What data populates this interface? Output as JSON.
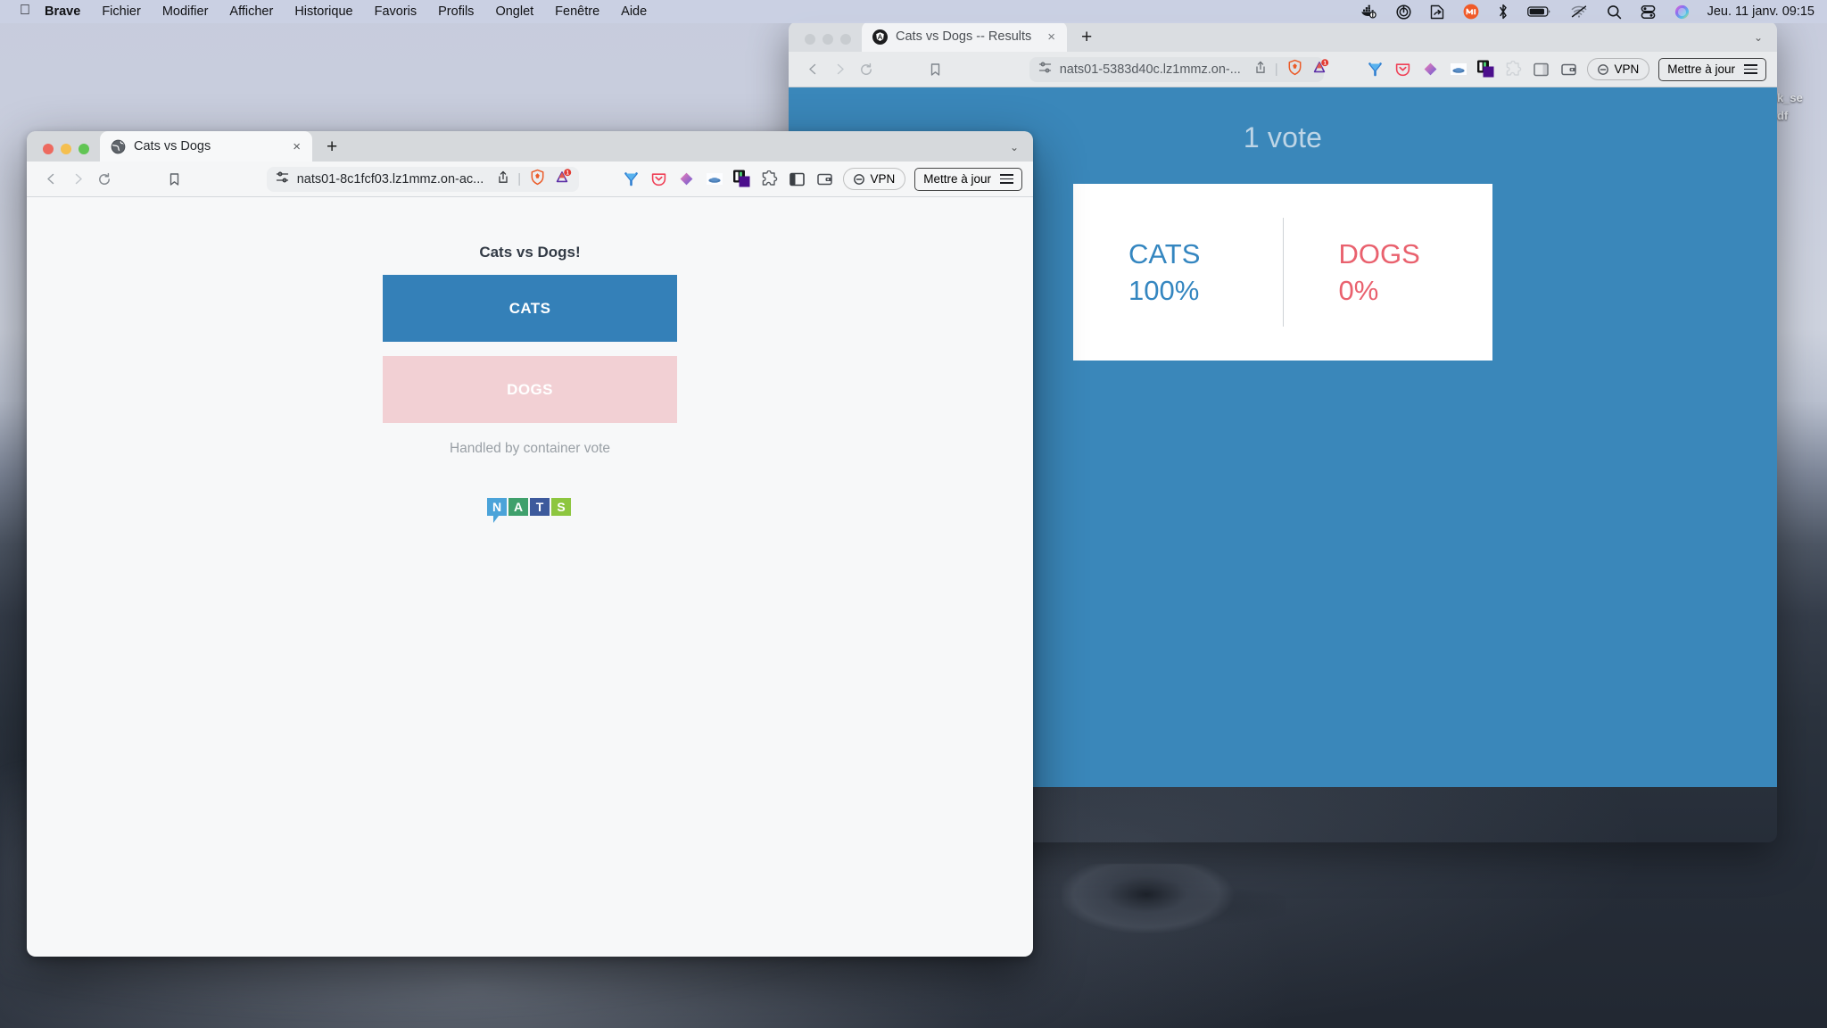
{
  "menubar": {
    "apple_icon": "apple-logo",
    "items": [
      {
        "label": "Brave",
        "bold": true
      },
      {
        "label": "Fichier",
        "bold": false
      },
      {
        "label": "Modifier",
        "bold": false
      },
      {
        "label": "Afficher",
        "bold": false
      },
      {
        "label": "Historique",
        "bold": false
      },
      {
        "label": "Favoris",
        "bold": false
      },
      {
        "label": "Profils",
        "bold": false
      },
      {
        "label": "Onglet",
        "bold": false
      },
      {
        "label": "Fenêtre",
        "bold": false
      },
      {
        "label": "Aide",
        "bold": false
      }
    ],
    "tray_icons": [
      "docker-icon",
      "power-icon",
      "screenshot-icon",
      "m-app-icon",
      "bluetooth-icon",
      "battery-icon",
      "wifi-off-icon",
      "search-icon",
      "control-center-icon",
      "siri-icon"
    ],
    "clock": "Jeu. 11 janv.  09:15"
  },
  "desktop": {
    "icon_labels": [
      "ok_se",
      "odf"
    ]
  },
  "back_window": {
    "tab": {
      "favicon": "angular-icon",
      "title": "Cats vs Dogs -- Results",
      "close_label": "×"
    },
    "newtab_label": "+",
    "chevron_label": "⌄",
    "toolbar": {
      "back_label": "◁",
      "forward_label": "▷",
      "reload_label": "↻",
      "bookmark_icon": "bookmark-icon",
      "permissions_icon": "site-settings-icon",
      "url": "nats01-5383d40c.lz1mmz.on-...",
      "share_icon": "share-icon",
      "brave_shield_icon": "brave-shield-icon",
      "notification_badge": "1",
      "vpn_label": "VPN",
      "update_label": "Mettre à jour",
      "extensions": [
        "yubico-icon",
        "pocket-icon",
        "diamond-icon",
        "cloud-icon",
        "purple-app-icon",
        "puzzle-icon",
        "sidebar-icon",
        "wallet-icon"
      ]
    },
    "page": {
      "vote_count": "1 vote",
      "cats_label": "CATS",
      "cats_percent": "100%",
      "dogs_label": "DOGS",
      "dogs_percent": "0%"
    }
  },
  "front_window": {
    "tab": {
      "favicon": "globe-icon",
      "title": "Cats vs Dogs",
      "close_label": "×"
    },
    "newtab_label": "+",
    "chevron_label": "⌄",
    "traffic_lights": {
      "close": "#ed6a5f",
      "minimize": "#f4bf4f",
      "zoom": "#61c554"
    },
    "toolbar": {
      "back_label": "◁",
      "forward_label": "▷",
      "reload_label": "↻",
      "bookmark_icon": "bookmark-icon",
      "permissions_icon": "site-settings-icon",
      "url": "nats01-8c1fcf03.lz1mmz.on-ac...",
      "share_icon": "share-icon",
      "brave_shield_icon": "brave-shield-icon",
      "notification_badge": "1",
      "vpn_label": "VPN",
      "update_label": "Mettre à jour",
      "extensions": [
        "yubico-icon",
        "pocket-icon",
        "diamond-icon",
        "cloud-icon",
        "purple-app-icon",
        "puzzle-icon",
        "sidebar-icon",
        "wallet-icon"
      ]
    },
    "page": {
      "title": "Cats vs Dogs!",
      "cats_button": "CATS",
      "dogs_button": "DOGS",
      "note": "Handled by container vote",
      "logo": {
        "name": "nats-logo",
        "letters": [
          "N",
          "A",
          "T",
          "S"
        ],
        "colors": [
          "#4ba3d9",
          "#3fa06c",
          "#3d5a9c",
          "#8dc63f"
        ]
      }
    }
  },
  "colors": {
    "cats_blue": "#3480b8",
    "dogs_pink": "#f2d0d4",
    "results_bg": "#3a87ba",
    "results_cats": "#3486c0",
    "results_dogs": "#e9616e",
    "votes_text": "#bed5e6"
  }
}
